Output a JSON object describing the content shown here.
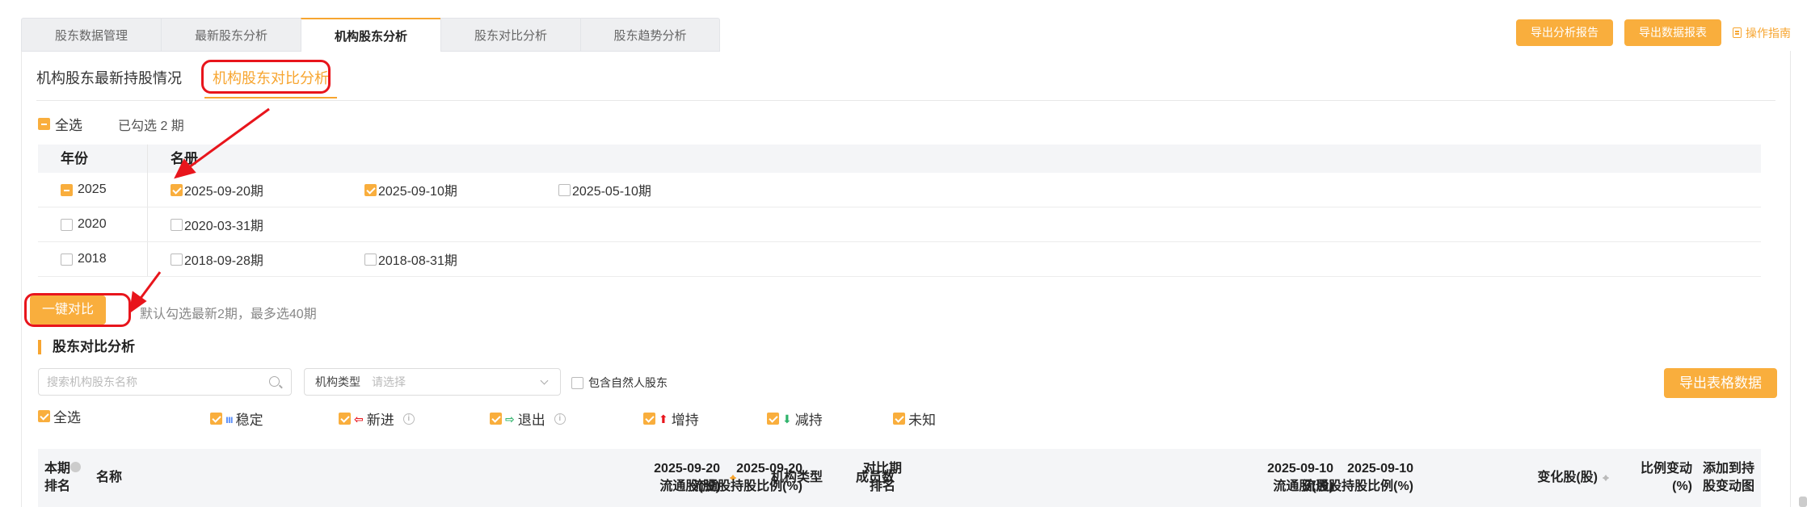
{
  "top_tabs": [
    "股东数据管理",
    "最新股东分析",
    "机构股东分析",
    "股东对比分析",
    "股东趋势分析"
  ],
  "top_actions": {
    "export_report": "导出分析报告",
    "export_data": "导出数据报表",
    "guide": "操作指南"
  },
  "subtabs": {
    "latest": "机构股东最新持股情况",
    "compare": "机构股东对比分析"
  },
  "select_all": "全选",
  "selected_count": "已勾选 2 期",
  "year_table": {
    "headers": {
      "year": "年份",
      "register": "名册"
    },
    "rows": [
      {
        "year": "2025",
        "state": "indeterminate",
        "periods": [
          {
            "label": "2025-09-20期",
            "checked": true
          },
          {
            "label": "2025-09-10期",
            "checked": true
          },
          {
            "label": "2025-05-10期",
            "checked": false
          }
        ]
      },
      {
        "year": "2020",
        "state": "unchecked",
        "periods": [
          {
            "label": "2020-03-31期",
            "checked": false
          }
        ]
      },
      {
        "year": "2018",
        "state": "unchecked",
        "periods": [
          {
            "label": "2018-09-28期",
            "checked": false
          },
          {
            "label": "2018-08-31期",
            "checked": false
          }
        ]
      }
    ]
  },
  "compare_button": "一键对比",
  "compare_hint": "默认勾选最新2期，最多选40期",
  "section_title": "股东对比分析",
  "search": {
    "placeholder": "搜索机构股东名称"
  },
  "type_select": {
    "label": "机构类型",
    "placeholder": "请选择"
  },
  "natural_person": "包含自然人股东",
  "export_table": "导出表格数据",
  "filters": [
    {
      "label": "全选",
      "icon": "",
      "icon_name": ""
    },
    {
      "label": "稳定",
      "icon": "ııı",
      "icon_name": "bars-icon",
      "color": "#5b8ff9"
    },
    {
      "label": "新进",
      "icon": "⇦",
      "icon_name": "enter-icon",
      "color": "#e8151c"
    },
    {
      "label": "退出",
      "icon": "⇨",
      "icon_name": "exit-icon",
      "color": "#2fb36b"
    },
    {
      "label": "增持",
      "icon": "⬆",
      "icon_name": "arrow-up-icon",
      "color": "#e8151c"
    },
    {
      "label": "减持",
      "icon": "⬇",
      "icon_name": "arrow-down-icon",
      "color": "#2fb36b"
    },
    {
      "label": "未知",
      "icon": "",
      "icon_name": ""
    }
  ],
  "table_headers": {
    "rank_l1": "本期",
    "rank_l2": "排名",
    "name": "名称",
    "type": "机构类型",
    "members": "成员数",
    "cur_shares_l1": "2025-09-20",
    "cur_shares_l2": "流通股(股)",
    "cur_ratio_l1": "2025-09-20",
    "cur_ratio_l2": "流通股持股比例(%)",
    "cmp_rank_l1": "对比期",
    "cmp_rank_l2": "排名",
    "cmp_shares_l1": "2025-09-10",
    "cmp_shares_l2": "流通股(股)",
    "cmp_ratio_l1": "2025-09-10",
    "cmp_ratio_l2": "流通股持股比例(%)",
    "change": "变化股(股)",
    "ratio_change_l1": "比例变动",
    "ratio_change_l2": "(%)",
    "add_l1": "添加到持",
    "add_l2": "股变动图"
  },
  "annotation_color": "#e8151c",
  "accent_color": "#f9ae3d"
}
